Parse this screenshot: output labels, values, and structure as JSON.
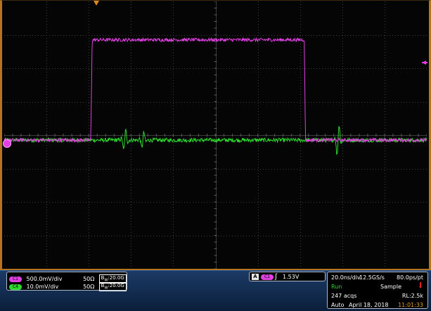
{
  "channels": [
    {
      "id": "C1",
      "scale": "500.0mV/div",
      "impedance": "50Ω",
      "bandwidth_prefix": "B",
      "bandwidth_sub": "W",
      "bandwidth": "20.0G",
      "color": "#e040e0"
    },
    {
      "id": "C4",
      "scale": "10.0mV/div",
      "impedance": "50Ω",
      "bandwidth_prefix": "B",
      "bandwidth_sub": "W",
      "bandwidth": "20.0G",
      "color": "#2fd82f"
    }
  ],
  "trigger": {
    "type": "A",
    "source": "C1",
    "slope_icon": "rising-edge-icon",
    "level": "1.53V"
  },
  "timebase": {
    "scale": "20.0ns/div",
    "sample_rate": "12.5GS/s",
    "resolution": "80.0ps/pt",
    "state": "Run",
    "acq_mode": "Sample",
    "acquisitions": "247 acqs",
    "record_length": "RL:2.5k",
    "trigger_mode": "Auto",
    "date": "April 18, 2018",
    "time": "11:01:33"
  },
  "colors": {
    "ch1": "#e040e0",
    "ch4": "#2fd82f",
    "frame": "#b7741e",
    "grid": "#3b3b3b",
    "background": "#050505"
  },
  "chart_data": {
    "type": "line",
    "divisions": {
      "x": 10,
      "y": 8
    },
    "series": [
      {
        "channel": "C1",
        "waveform": "pulse",
        "baseline_div": -0.15,
        "high_div": 2.85,
        "rise_div": 2.05,
        "fall_div": 7.1,
        "noise_div": 0.05
      },
      {
        "channel": "C4",
        "waveform": "baseline",
        "baseline_div": -0.15,
        "noise_div": 0.06,
        "disturbances": [
          {
            "at_div": 2.85,
            "amplitude_div": 0.35
          },
          {
            "at_div": 3.28,
            "amplitude_div": 0.28
          },
          {
            "at_div": 7.9,
            "amplitude_div": 0.55
          }
        ]
      }
    ]
  }
}
